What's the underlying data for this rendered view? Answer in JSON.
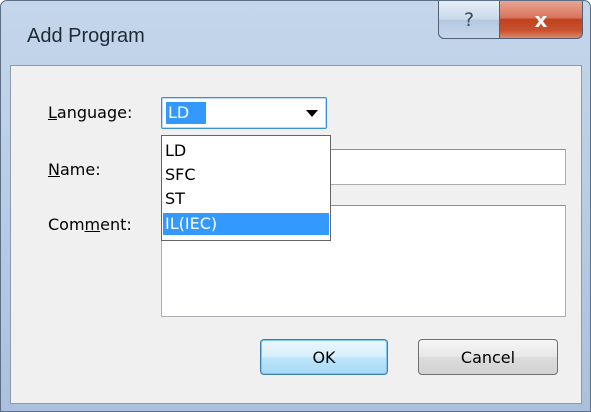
{
  "window": {
    "title": "Add Program",
    "help_glyph": "?",
    "close_glyph": "x"
  },
  "form": {
    "language_label_ul": "L",
    "language_label_rest": "anguage:",
    "name_label_ul": "N",
    "name_label_rest": "ame:",
    "comment_label_pre": "Com",
    "comment_label_ul": "m",
    "comment_label_post": "ent:",
    "language_selected": "LD",
    "name_value": "",
    "comment_value": ""
  },
  "dropdown": {
    "options": [
      "LD",
      "SFC",
      "ST",
      "IL(IEC)"
    ],
    "highlighted_index": 3
  },
  "buttons": {
    "ok_label": "OK",
    "cancel_label": "Cancel"
  },
  "colors": {
    "selection": "#3399ff",
    "close_button": "#c1411f",
    "frame": "#b9cde5"
  }
}
